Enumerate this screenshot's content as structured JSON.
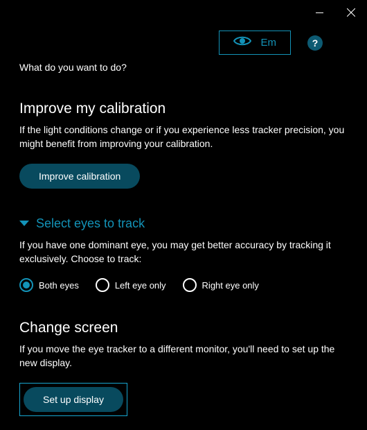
{
  "profile": {
    "label": "Em"
  },
  "help_icon_text": "?",
  "prompt": "What do you want to do?",
  "calibration": {
    "title": "Improve my calibration",
    "body": "If the light conditions change or if you experience less tracker precision, you might benefit from improving your calibration.",
    "button": "Improve calibration"
  },
  "eyes": {
    "title": "Select eyes to track",
    "body": "If you have one dominant eye, you may get better accuracy by tracking it exclusively. Choose to track:",
    "options": {
      "both": "Both eyes",
      "left": "Left eye only",
      "right": "Right eye only"
    },
    "selected": "both"
  },
  "screen": {
    "title": "Change screen",
    "body": "If you move the eye tracker to a different monitor, you'll need to set up the new display.",
    "button": "Set up display"
  }
}
